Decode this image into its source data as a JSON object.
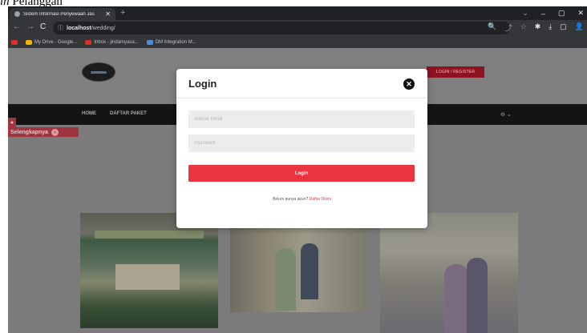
{
  "caption": {
    "before": "",
    "italic": "in",
    "after": " Pelanggan"
  },
  "browser": {
    "tab_title": "Sistem Informasi Penyewaan Jas",
    "tab_close": "✕",
    "new_tab": "+",
    "window_controls": [
      "⌄",
      "–",
      "▢",
      "✕"
    ],
    "nav": {
      "back": "←",
      "forward": "→",
      "reload": "C"
    },
    "address": {
      "info_icon": "ⓘ",
      "host": "localhost",
      "path": "/wedding/"
    },
    "toolbar_icons": [
      "🔍",
      "⤴",
      "☆",
      "✱",
      "⤓",
      "▢",
      "👤"
    ],
    "bookmarks": [
      {
        "label": "My Drive - Google...",
        "color": "#f4b400"
      },
      {
        "label": "Inbox - jindamyasa...",
        "color": "#d93025"
      },
      {
        "label": "DM Integration M...",
        "color": "#4a90d9"
      }
    ]
  },
  "site": {
    "login_register": "LOGIN / REGISTER",
    "menu": [
      "HOME",
      "DAFTAR PAKET"
    ],
    "account_icon": "⊖ ⌄",
    "dot_button": "●",
    "more_label": "Selengkapnya",
    "more_arrow": "›",
    "colors": {
      "header": "#7f7f7f",
      "menubar": "#141414",
      "accent": "#ec3340"
    }
  },
  "modal": {
    "title": "Login",
    "close": "✕",
    "email_placeholder": "Alamat Email",
    "password_placeholder": "Password",
    "submit_label": "Login",
    "register_prompt": "Belum punya akun?",
    "register_link": "Daftar Disini"
  }
}
